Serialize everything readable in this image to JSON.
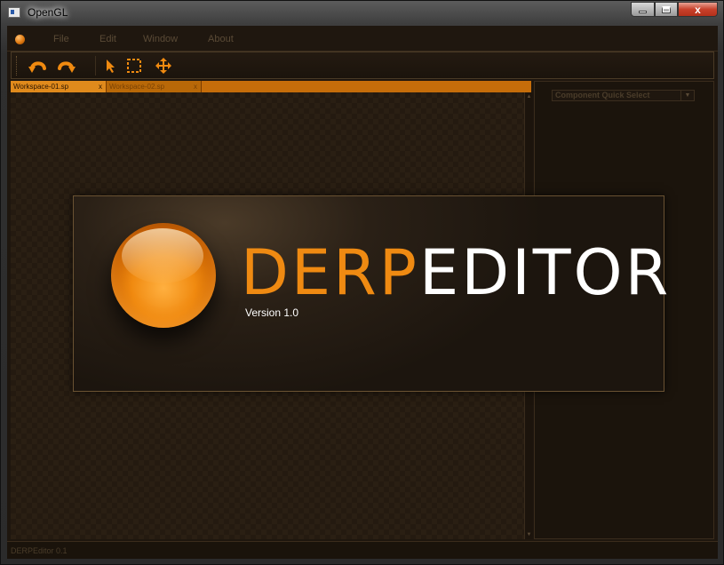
{
  "window": {
    "title": "OpenGL",
    "close_glyph": "x"
  },
  "menubar": {
    "items": [
      "File",
      "Edit",
      "Window",
      "About"
    ]
  },
  "toolbar": {
    "icons": [
      "undo-icon",
      "redo-icon",
      "pointer-icon",
      "marquee-select-icon",
      "move-icon"
    ]
  },
  "tabs": [
    {
      "label": "Workspace-01.sp",
      "close": "x"
    },
    {
      "label": "Workspace-02.sp",
      "close": "x"
    }
  ],
  "right_panel": {
    "combo_value": "Component Quick Select"
  },
  "status": {
    "text": "DERPEditor 0.1"
  },
  "splash": {
    "logo_part1": "DERP",
    "logo_part2": "EDITOR",
    "version": "Version 1.0"
  },
  "colors": {
    "accent": "#ef8a12",
    "background": "#1e160e",
    "panel_border": "#3a2c1c"
  }
}
